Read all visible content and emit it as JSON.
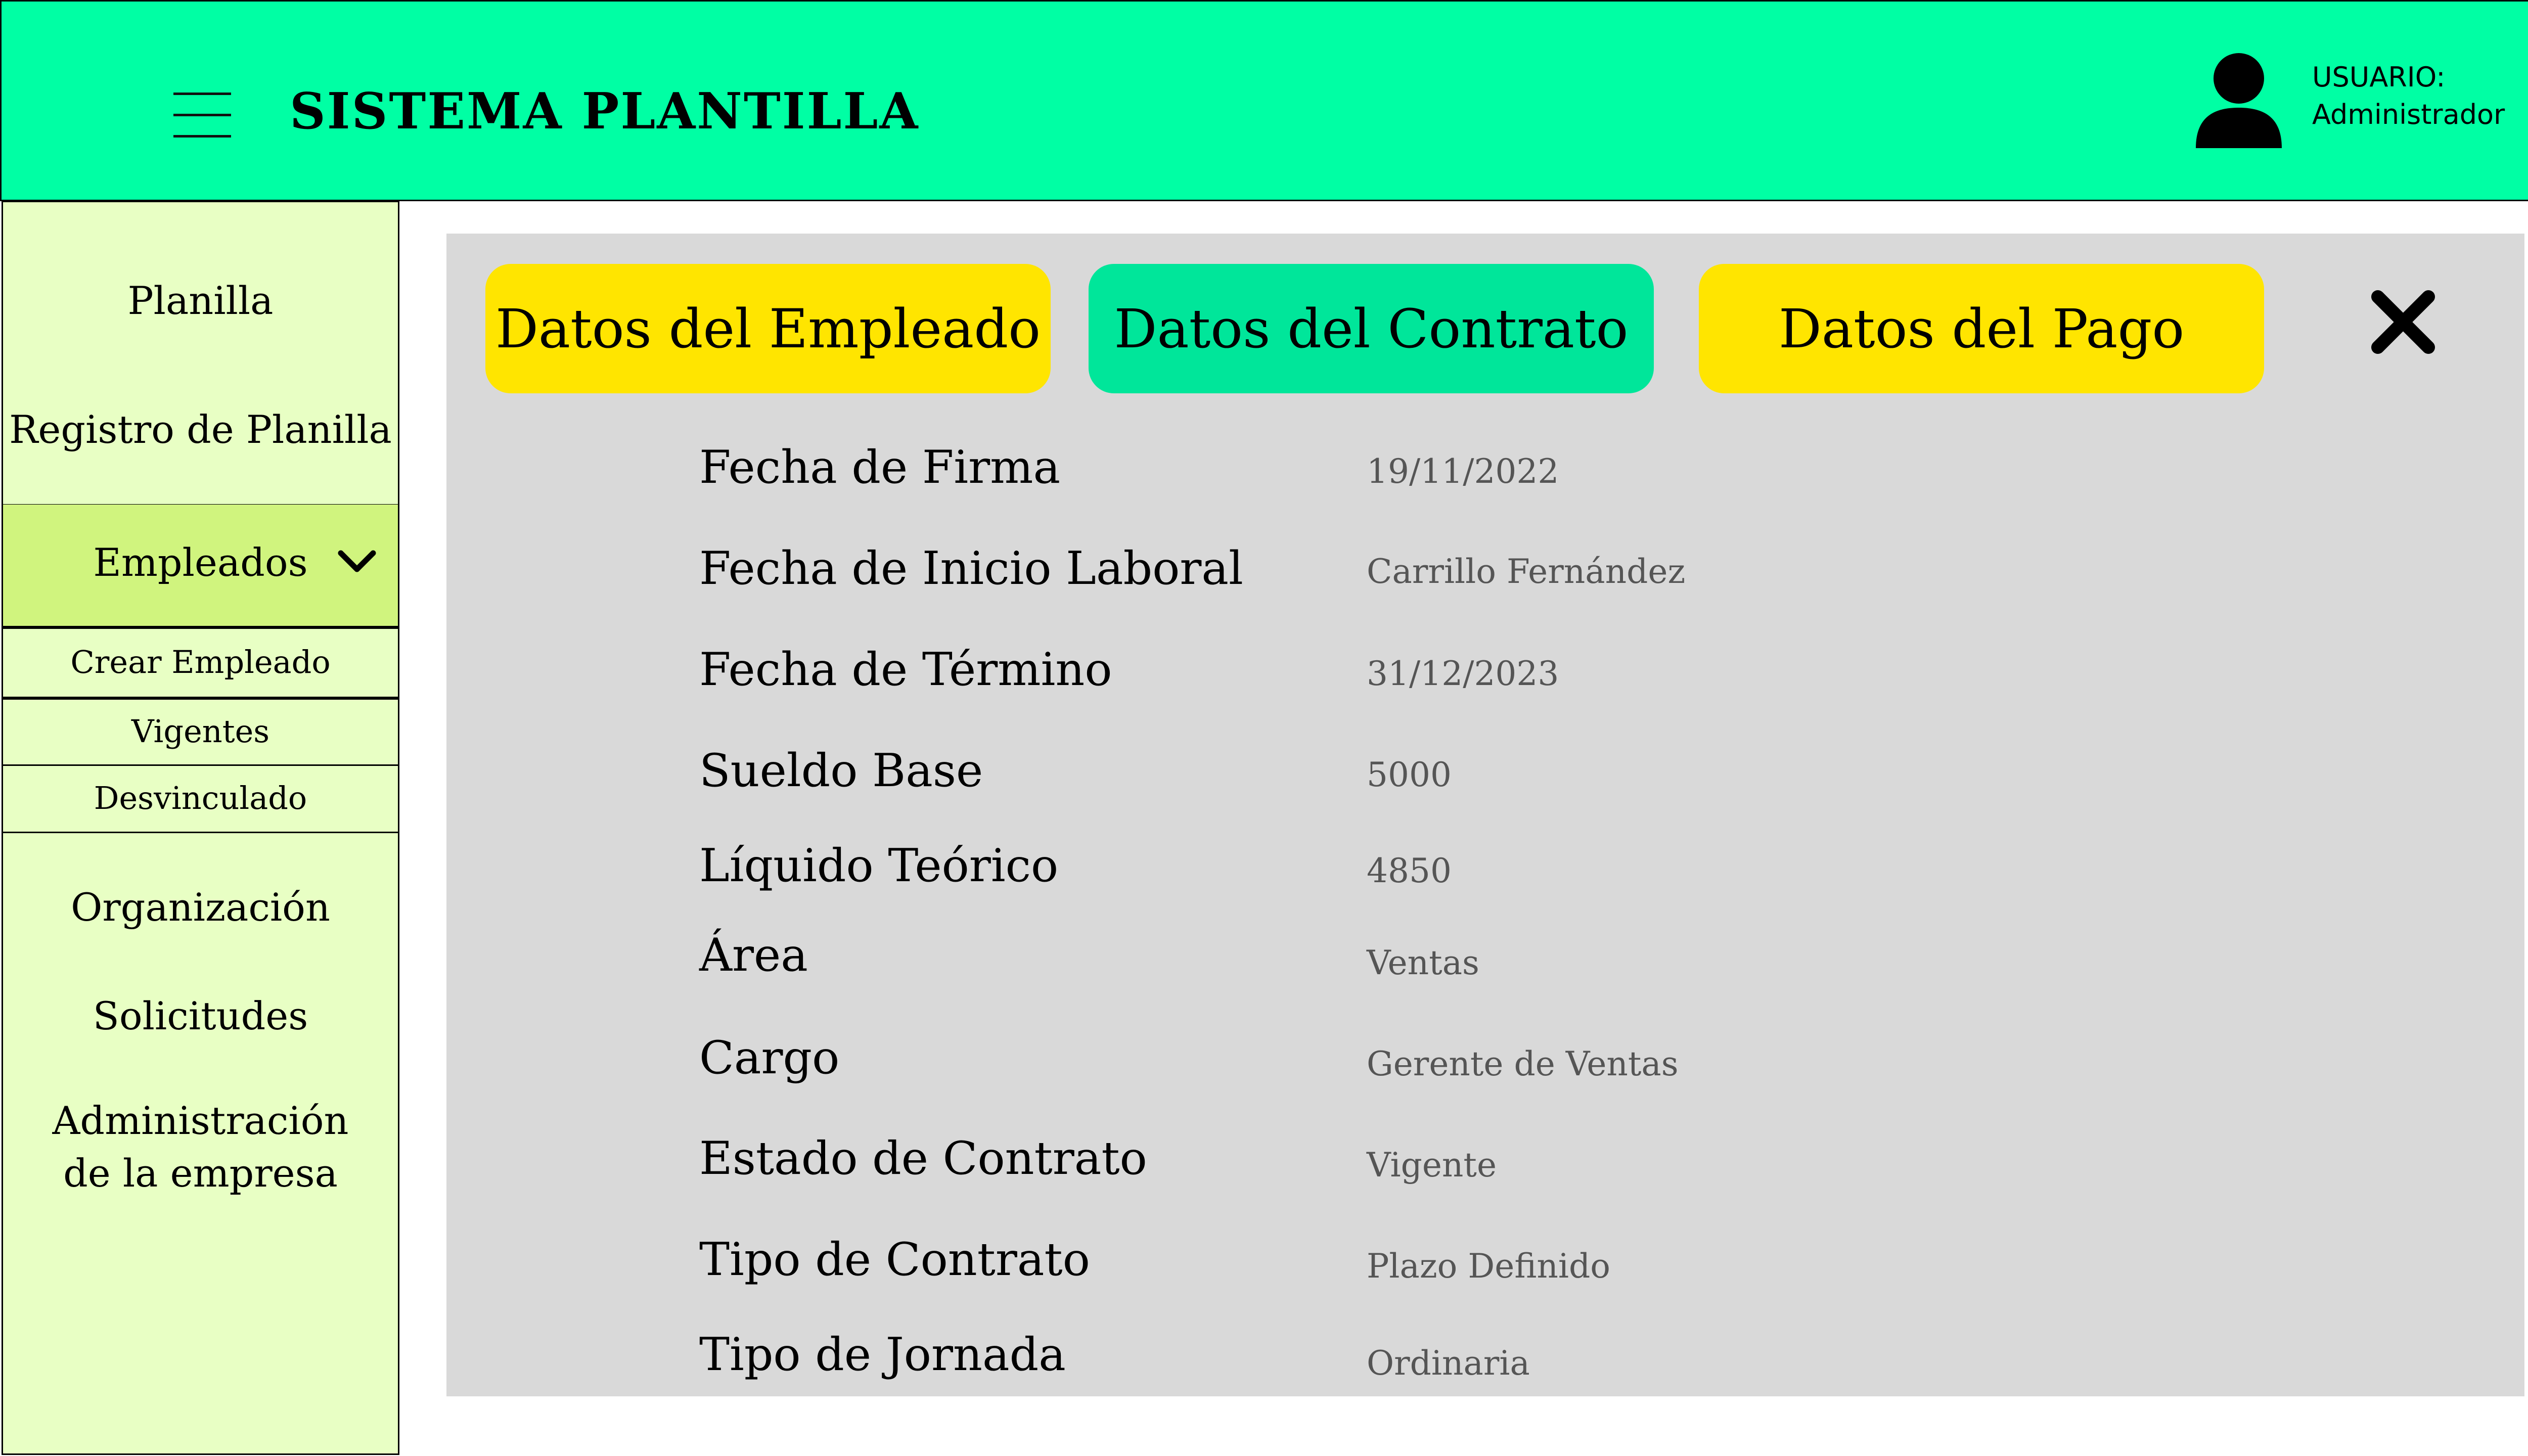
{
  "header": {
    "title": "SISTEMA PLANTILLA",
    "user_label": "USUARIO:",
    "user_name": "Administrador",
    "background": "#00ffa4"
  },
  "sidebar": {
    "items": [
      {
        "label": "Planilla"
      },
      {
        "label": "Registro de Planilla"
      },
      {
        "label": "Empleados",
        "active": true,
        "icon": "chevron-down-icon"
      },
      {
        "label": "Organización"
      },
      {
        "label": "Solicitudes"
      },
      {
        "label": "Administración",
        "label2": "de la empresa"
      }
    ],
    "sub_items": [
      {
        "label": "Crear Empleado"
      },
      {
        "label": "Vigentes"
      },
      {
        "label": "Desvinculado"
      }
    ],
    "background": "#e8ffc4",
    "active_background": "#d0f47e"
  },
  "tabs": [
    {
      "label": "Datos del Empleado",
      "color": "#ffe500"
    },
    {
      "label": "Datos del Contrato",
      "color": "#00e69a",
      "selected": true
    },
    {
      "label": "Datos del Pago",
      "color": "#ffe500"
    }
  ],
  "close_icon": "close-icon",
  "contract_fields": [
    {
      "label": "Fecha de Firma",
      "value": "19/11/2022"
    },
    {
      "label": "Fecha de Inicio Laboral",
      "value": "Carrillo Fernández"
    },
    {
      "label": "Fecha de Término",
      "value": "31/12/2023"
    },
    {
      "label": "Sueldo Base",
      "value": "5000"
    },
    {
      "label": "Líquido Teórico",
      "value": "4850"
    },
    {
      "label": "Área",
      "value": "Ventas"
    },
    {
      "label": "Cargo",
      "value": "Gerente de Ventas"
    },
    {
      "label": "Estado de Contrato",
      "value": "Vigente"
    },
    {
      "label": "Tipo de Contrato",
      "value": "Plazo Definido"
    },
    {
      "label": "Tipo de Jornada",
      "value": "Ordinaria"
    }
  ]
}
